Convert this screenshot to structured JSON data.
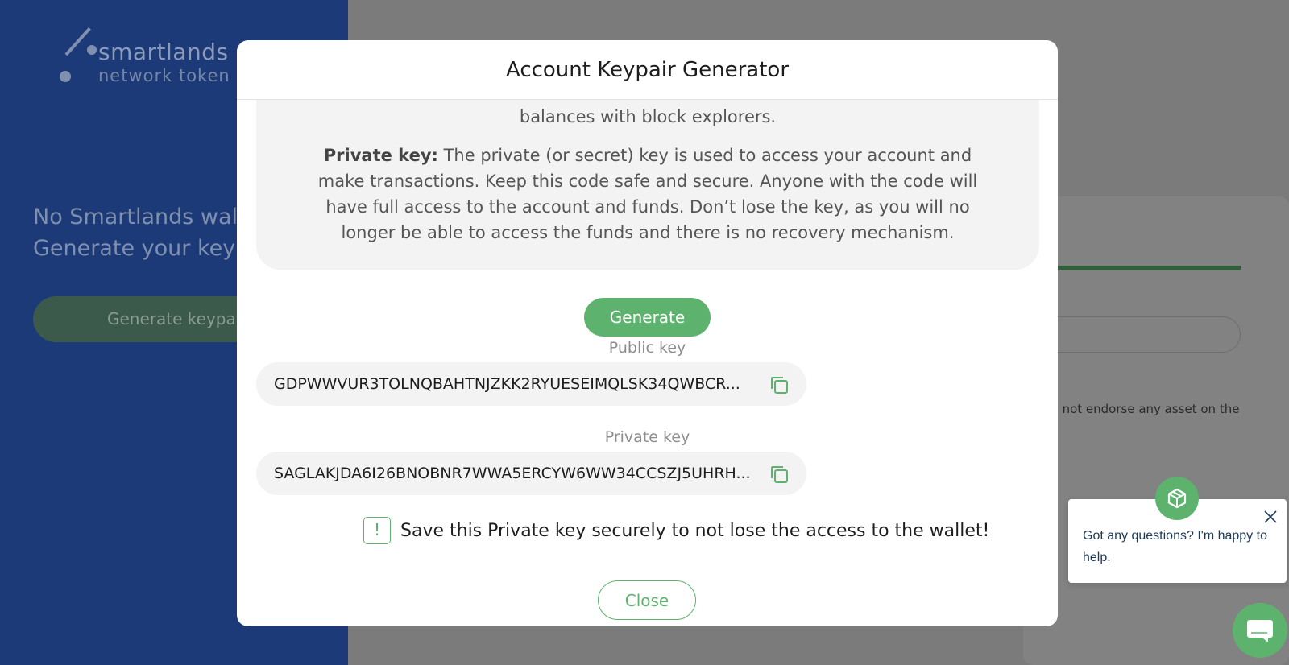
{
  "background": {
    "logo": {
      "name": "smartlands",
      "subtitle": "network token"
    },
    "message_line1": "No Smartlands walle",
    "message_line2": "Generate your keypa",
    "generate_button_label": "Generate keypair",
    "disclaimer_fragment": "s not endorse any asset on the",
    "colors": {
      "sidebar": "#1c3a78",
      "accent": "#5db36e"
    }
  },
  "modal": {
    "title": "Account Keypair Generator",
    "info_line1": "balances with block explorers.",
    "private_key_term": "Private key:",
    "private_key_desc": " The private (or secret) key is used to access your account and make transactions. Keep this code safe and secure. Anyone with the code will have full access to the account and funds. Don’t lose the key, as you will no longer be able to access the funds and there is no recovery mechanism.",
    "generate_label": "Generate",
    "public_key_label": "Public key",
    "public_key_value": "GDPWWVUR3TOLNQBAHTNJZKK2RYUESEIMQLSK34QWBCR...",
    "private_key_label": "Private key",
    "private_key_value": "SAGLAKJDA6I26BNOBNR7WWA5ERCYW6WW34CCSZJ5UHRH...",
    "warning_icon": "!",
    "warning_text": "Save this Private key securely to not lose the access to the wallet!",
    "close_label": "Close"
  },
  "chat": {
    "message": "Got any questions? I'm happy to help."
  }
}
